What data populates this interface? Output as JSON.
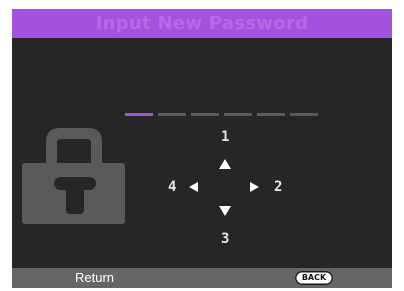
{
  "header": {
    "title": "Input New Password"
  },
  "password": {
    "total_digits": 6,
    "entered_digits": 1
  },
  "keypad": {
    "up_number": "1",
    "right_number": "2",
    "down_number": "3",
    "left_number": "4"
  },
  "footer": {
    "return_label": "Return",
    "back_button_label": "BACK"
  },
  "icons": {
    "lock": "lock-icon",
    "up": "arrow-up-icon",
    "down": "arrow-down-icon",
    "left": "arrow-left-icon",
    "right": "arrow-right-icon"
  },
  "colors": {
    "accent": "#a352e0",
    "background": "#262626",
    "footer": "#666666",
    "lock": "#5a5a5a",
    "inactive_dash": "#5a5a5a",
    "text": "#ffffff"
  }
}
